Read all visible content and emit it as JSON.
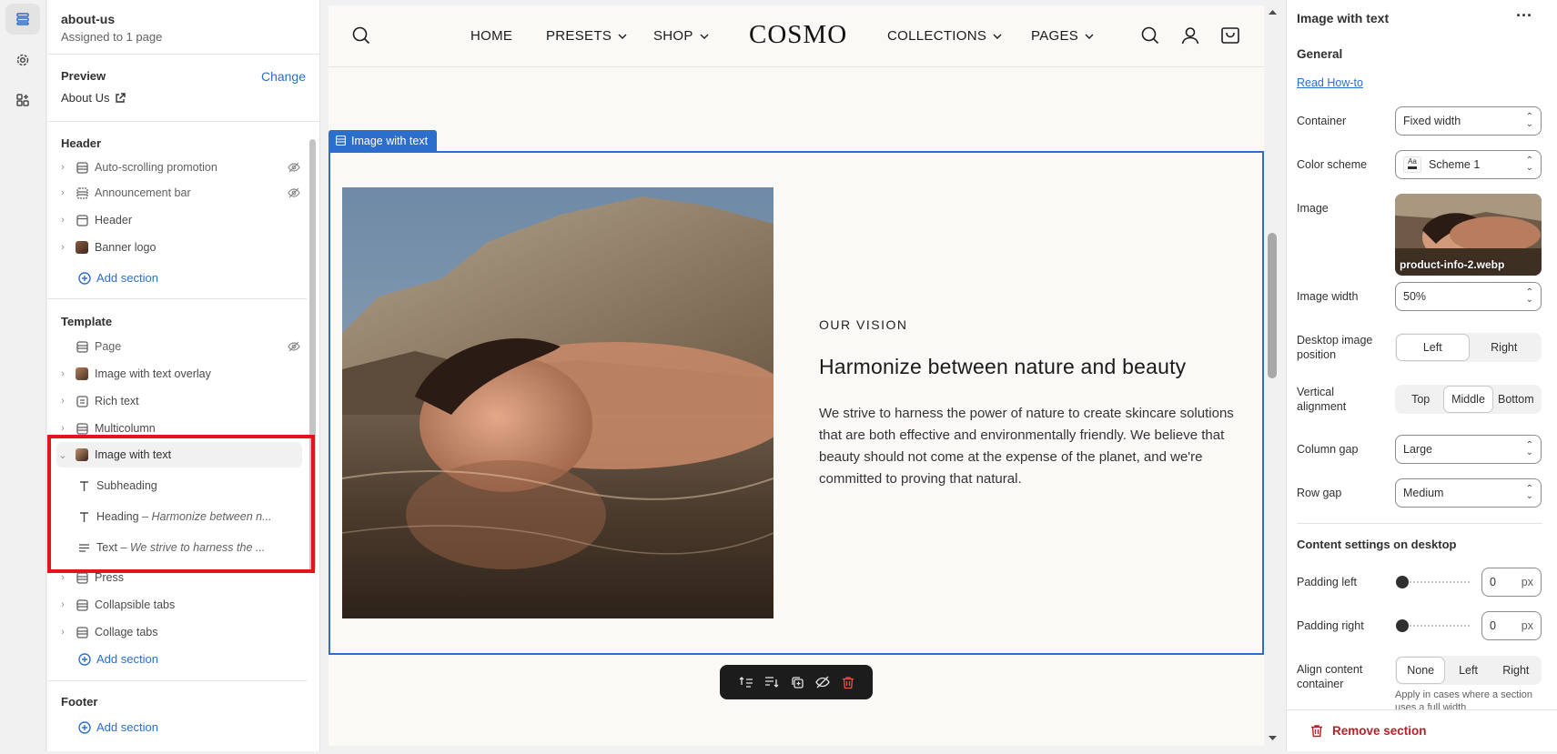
{
  "rail": {
    "items": [
      "sections-icon",
      "settings-icon",
      "apps-icon"
    ]
  },
  "left_panel": {
    "page_name": "about-us",
    "assigned": "Assigned to 1 page",
    "preview_label": "Preview",
    "change_label": "Change",
    "preview_page": "About Us",
    "header_group": {
      "title": "Header",
      "items": [
        {
          "label": "Auto-scrolling promotion",
          "hidden": true
        },
        {
          "label": "Announcement bar",
          "hidden": true
        },
        {
          "label": "Header",
          "hidden": false
        },
        {
          "label": "Banner logo",
          "hidden": false
        }
      ],
      "add_label": "Add section"
    },
    "template_group": {
      "title": "Template",
      "items": [
        {
          "label": "Page"
        },
        {
          "label": "Image with text overlay"
        },
        {
          "label": "Rich text"
        },
        {
          "label": "Multicolumn"
        },
        {
          "label": "Image with text"
        },
        {
          "label": "Press"
        },
        {
          "label": "Collapsible tabs"
        },
        {
          "label": "Collage tabs"
        }
      ],
      "children": [
        {
          "label": "Subheading",
          "detail": ""
        },
        {
          "label": "Heading",
          "detail": "Harmonize between n..."
        },
        {
          "label": "Text",
          "detail": "We strive to harness the ..."
        }
      ],
      "add_label": "Add section"
    },
    "footer_group": {
      "title": "Footer",
      "add_label": "Add section"
    }
  },
  "site": {
    "nav_left": [
      "HOME",
      "PRESETS",
      "SHOP"
    ],
    "logo": "COSMO",
    "nav_right": [
      "COLLECTIONS",
      "PAGES"
    ],
    "section_tag": "Image with text",
    "subheading": "OUR VISION",
    "heading": "Harmonize between nature and beauty",
    "body": "We strive to harness the power of nature to create skincare solutions that are both effective and environmentally friendly. We believe that beauty should not come at the expense of the planet, and we're committed to proving that natural."
  },
  "toolbar": [
    "move-up-icon",
    "move-down-icon",
    "duplicate-icon",
    "hide-icon",
    "delete-icon"
  ],
  "right_panel": {
    "title": "Image with text",
    "general": "General",
    "read_howto": "Read How-to",
    "container_label": "Container",
    "container_value": "Fixed width",
    "color_scheme_label": "Color scheme",
    "color_scheme_value": "Scheme 1",
    "image_label": "Image",
    "image_file": "product-info-2.webp",
    "image_width_label": "Image width",
    "image_width_value": "50%",
    "desktop_pos_label": "Desktop image position",
    "desktop_pos_options": [
      "Left",
      "Right"
    ],
    "desktop_pos_selected": "Left",
    "valign_label": "Vertical alignment",
    "valign_options": [
      "Top",
      "Middle",
      "Bottom"
    ],
    "valign_selected": "Middle",
    "column_gap_label": "Column gap",
    "column_gap_value": "Large",
    "row_gap_label": "Row gap",
    "row_gap_value": "Medium",
    "content_desktop": "Content settings on desktop",
    "padding_left_label": "Padding left",
    "padding_left_value": "0",
    "padding_right_label": "Padding right",
    "padding_right_value": "0",
    "unit": "px",
    "align_label": "Align content container",
    "align_options": [
      "None",
      "Left",
      "Right"
    ],
    "align_selected": "None",
    "align_hint": "Apply in cases where a section uses a full width",
    "remove_label": "Remove section"
  }
}
